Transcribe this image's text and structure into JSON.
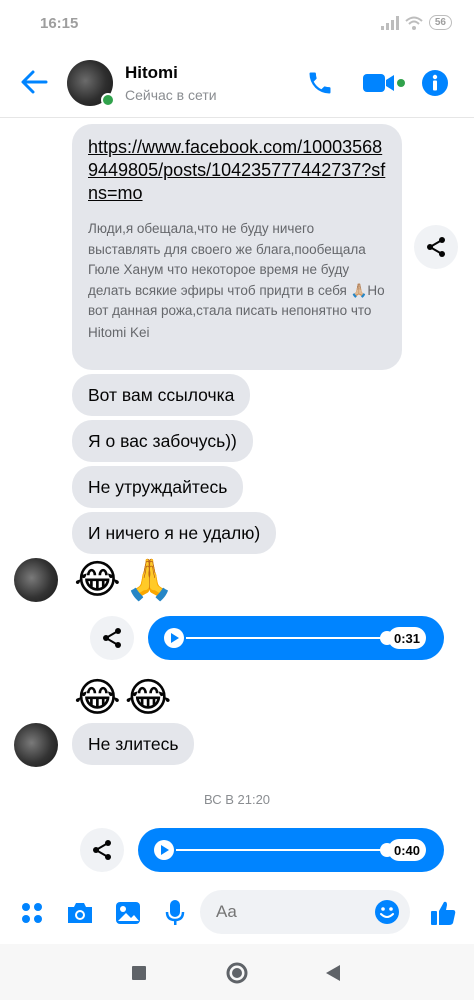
{
  "status_bar": {
    "time": "16:15",
    "battery": "56"
  },
  "header": {
    "name": "Hitomi",
    "status": "Сейчас в сети"
  },
  "colors": {
    "accent": "#0084ff",
    "bubble": "#e4e6eb",
    "online": "#31a24c"
  },
  "messages": {
    "link_card": {
      "url": "https://www.facebook.com/100035689449805/posts/104235777442737?sfns=mo",
      "preview": "Люди,я обещала,что не буду ничего выставлять для своего же блага,пообещала Гюле Ханум что некоторое время не буду делать всякие эфиры чтоб придти в себя 🙏🏼Но вот данная рожа,стала писать непонятно что",
      "author": "Hitomi Kei"
    },
    "texts": [
      "Вот вам ссылочка",
      "Я о вас забочусь))",
      "Не утруждайтесь",
      "И ничего я не удалю)"
    ],
    "emoji_1": [
      "😂",
      "🙏"
    ],
    "voice_1": {
      "duration": "0:31"
    },
    "emoji_2": [
      "😂",
      "😂"
    ],
    "reply": "Не злитесь",
    "timestamp": "ВС В 21:20",
    "voice_2": {
      "duration": "0:40"
    }
  },
  "composer": {
    "placeholder": "Aa"
  },
  "icons": {
    "back": "arrow-left-icon",
    "call": "phone-icon",
    "video": "video-camera-icon",
    "info": "info-icon",
    "share": "share-icon",
    "menu": "grid-dots-icon",
    "camera": "camera-icon",
    "gallery": "image-icon",
    "mic": "microphone-icon",
    "emoji": "smiley-icon",
    "like": "thumbs-up-icon"
  }
}
